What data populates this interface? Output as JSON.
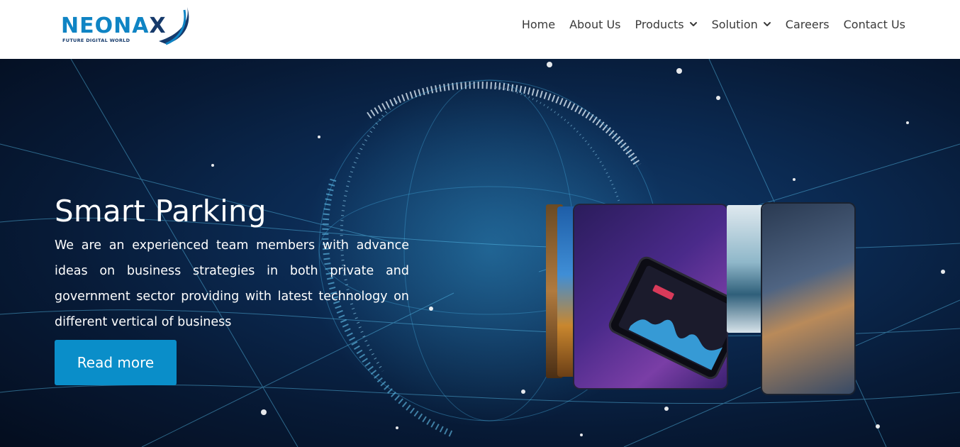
{
  "brand": {
    "name_main": "NEONA",
    "name_x": "X",
    "tagline": "FUTURE DIGITAL WORLD",
    "primary_color": "#0f84c4",
    "dark_color": "#163a6b"
  },
  "nav": {
    "items": [
      {
        "label": "Home",
        "has_dropdown": false
      },
      {
        "label": "About Us",
        "has_dropdown": false
      },
      {
        "label": "Products",
        "has_dropdown": true,
        "icon": "chevron-down-icon"
      },
      {
        "label": "Solution",
        "has_dropdown": true,
        "icon": "chevron-down-icon"
      },
      {
        "label": "Careers",
        "has_dropdown": false
      },
      {
        "label": "Contact Us",
        "has_dropdown": false
      }
    ]
  },
  "hero": {
    "title": "Smart Parking",
    "description": "We are an experienced team members with advance ideas on business strategies in both private and government sector providing with latest technology on different vertical of business",
    "button_label": "Read more",
    "button_color": "#0a8ec9"
  }
}
